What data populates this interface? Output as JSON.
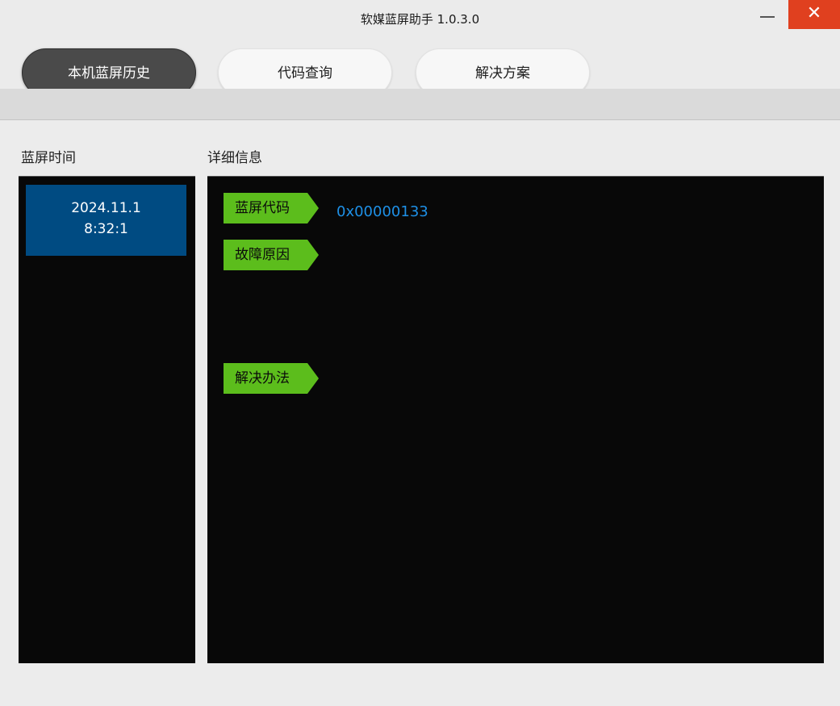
{
  "window": {
    "title": "软媒蓝屏助手 1.0.3.0",
    "close_symbol": "✕"
  },
  "tabs": [
    {
      "label": "本机蓝屏历史",
      "active": true
    },
    {
      "label": "代码查询",
      "active": false
    },
    {
      "label": "解决方案",
      "active": false
    }
  ],
  "left": {
    "heading": "蓝屏时间",
    "items": [
      {
        "date": "2024.11.1",
        "time": "8:32:1",
        "selected": true
      }
    ]
  },
  "right": {
    "heading": "详细信息",
    "fields": {
      "code_label": "蓝屏代码",
      "code_value": "0x00000133",
      "reason_label": "故障原因",
      "reason_value": "",
      "solution_label": "解决办法",
      "solution_value": ""
    }
  },
  "colors": {
    "accent_green": "#5cbd1c",
    "selected_blue": "#004b82",
    "code_blue": "#1e90e6",
    "close_red": "#e0401f"
  },
  "icons": {
    "minimize": "minimize-icon",
    "close": "close-icon"
  }
}
